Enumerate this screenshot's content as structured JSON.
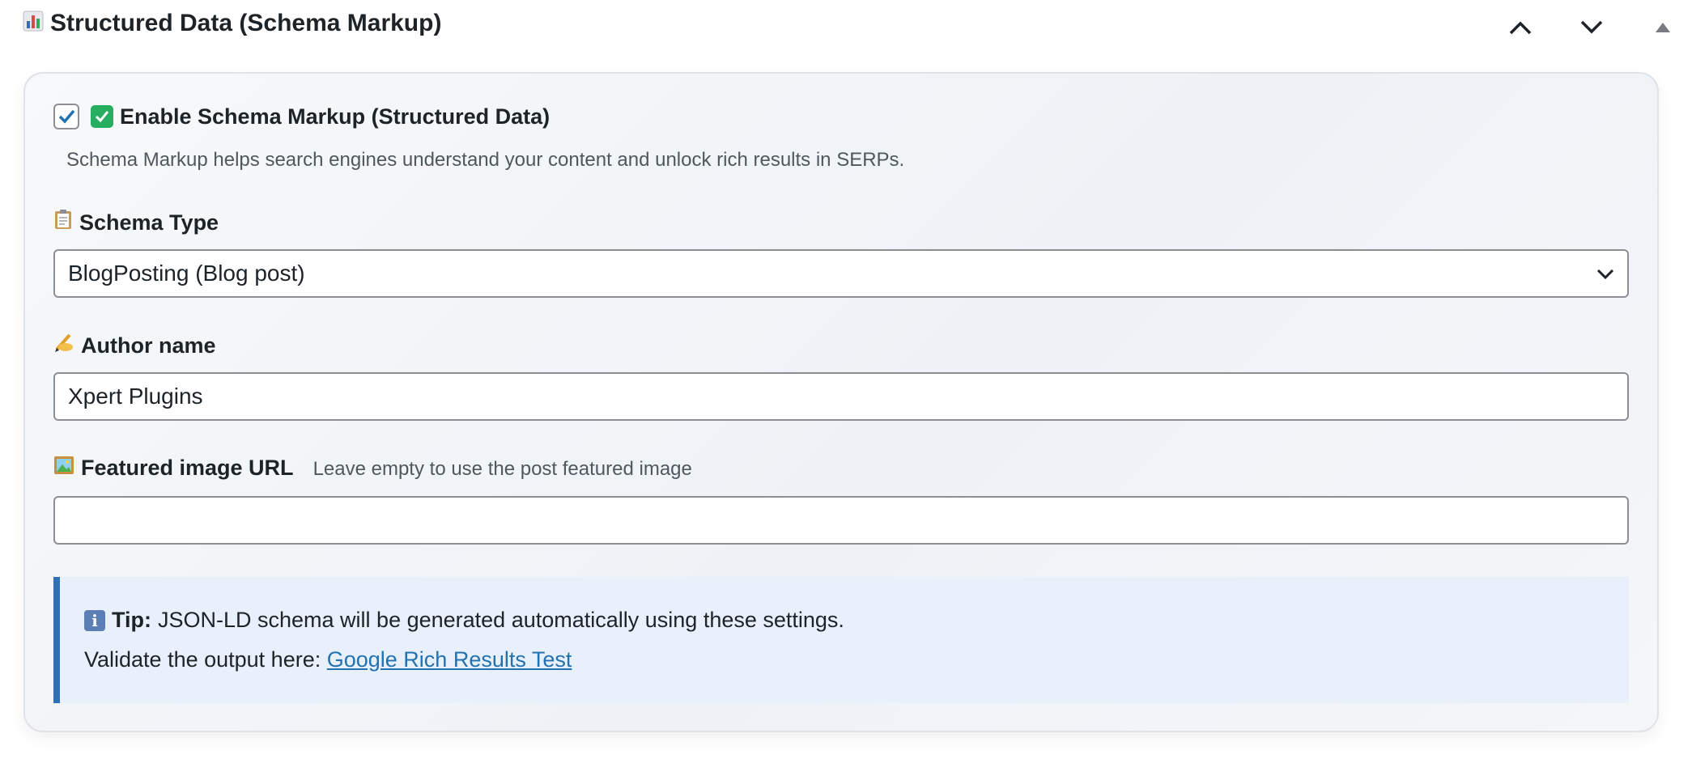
{
  "header": {
    "icon": "bar-chart-icon",
    "title": "Structured Data (Schema Markup)"
  },
  "enable": {
    "checked": true,
    "label": "Enable Schema Markup (Structured Data)",
    "help": "Schema Markup helps search engines understand your content and unlock rich results in SERPs."
  },
  "schema_type": {
    "label": "Schema Type",
    "icon": "clipboard-icon",
    "value": "BlogPosting (Blog post)"
  },
  "author": {
    "label": "Author name",
    "icon": "writing-hand-icon",
    "value": "Xpert Plugins"
  },
  "featured_image": {
    "label": "Featured image URL",
    "icon": "framed-picture-icon",
    "hint": "Leave empty to use the post featured image",
    "value": ""
  },
  "tip": {
    "strong": "Tip:",
    "text": "JSON-LD schema will be generated automatically using these settings.",
    "validate_text": "Validate the output here:",
    "link_text": "Google Rich Results Test"
  },
  "colors": {
    "accent": "#2e6fb7",
    "tip_bg": "#e8f1fb",
    "link": "#2271b1"
  }
}
